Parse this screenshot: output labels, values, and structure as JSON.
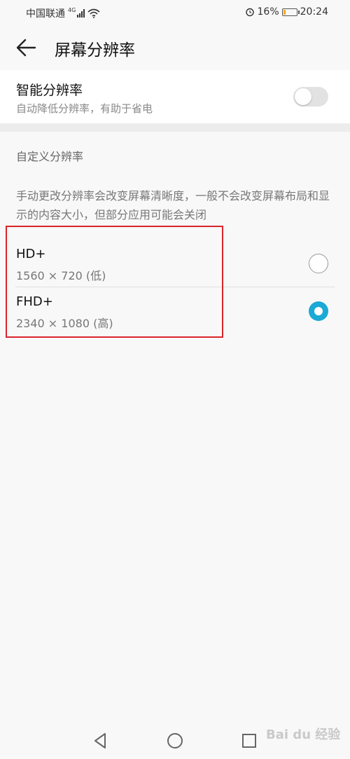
{
  "status_bar": {
    "carrier": "中国联通",
    "network": "4G",
    "battery_percent": "16%",
    "battery_level": 0.16,
    "time": "20:24",
    "icons": [
      "signal-icon",
      "wifi-icon",
      "alarm-icon",
      "battery-icon"
    ]
  },
  "header": {
    "title": "屏幕分辨率",
    "back_icon": "arrow-left-icon"
  },
  "smart_resolution": {
    "title": "智能分辨率",
    "subtitle": "自动降低分辨率，有助于省电",
    "enabled": false
  },
  "custom": {
    "header": "自定义分辨率",
    "description": "手动更改分辨率会改变屏幕清晰度，一般不会改变屏幕布局和显示的内容大小，但部分应用可能会关闭",
    "options": [
      {
        "label": "HD+",
        "detail": "1560 × 720 (低)",
        "selected": false
      },
      {
        "label": "FHD+",
        "detail": "2340 × 1080 (高)",
        "selected": true
      }
    ]
  },
  "nav_bar": {
    "icons": [
      "nav-back-icon",
      "nav-home-icon",
      "nav-recents-icon"
    ]
  },
  "colors": {
    "accent": "#1ba9d6",
    "highlight_border": "#d9252b",
    "battery": "#f5a623"
  },
  "watermark": "Bai du 经验"
}
